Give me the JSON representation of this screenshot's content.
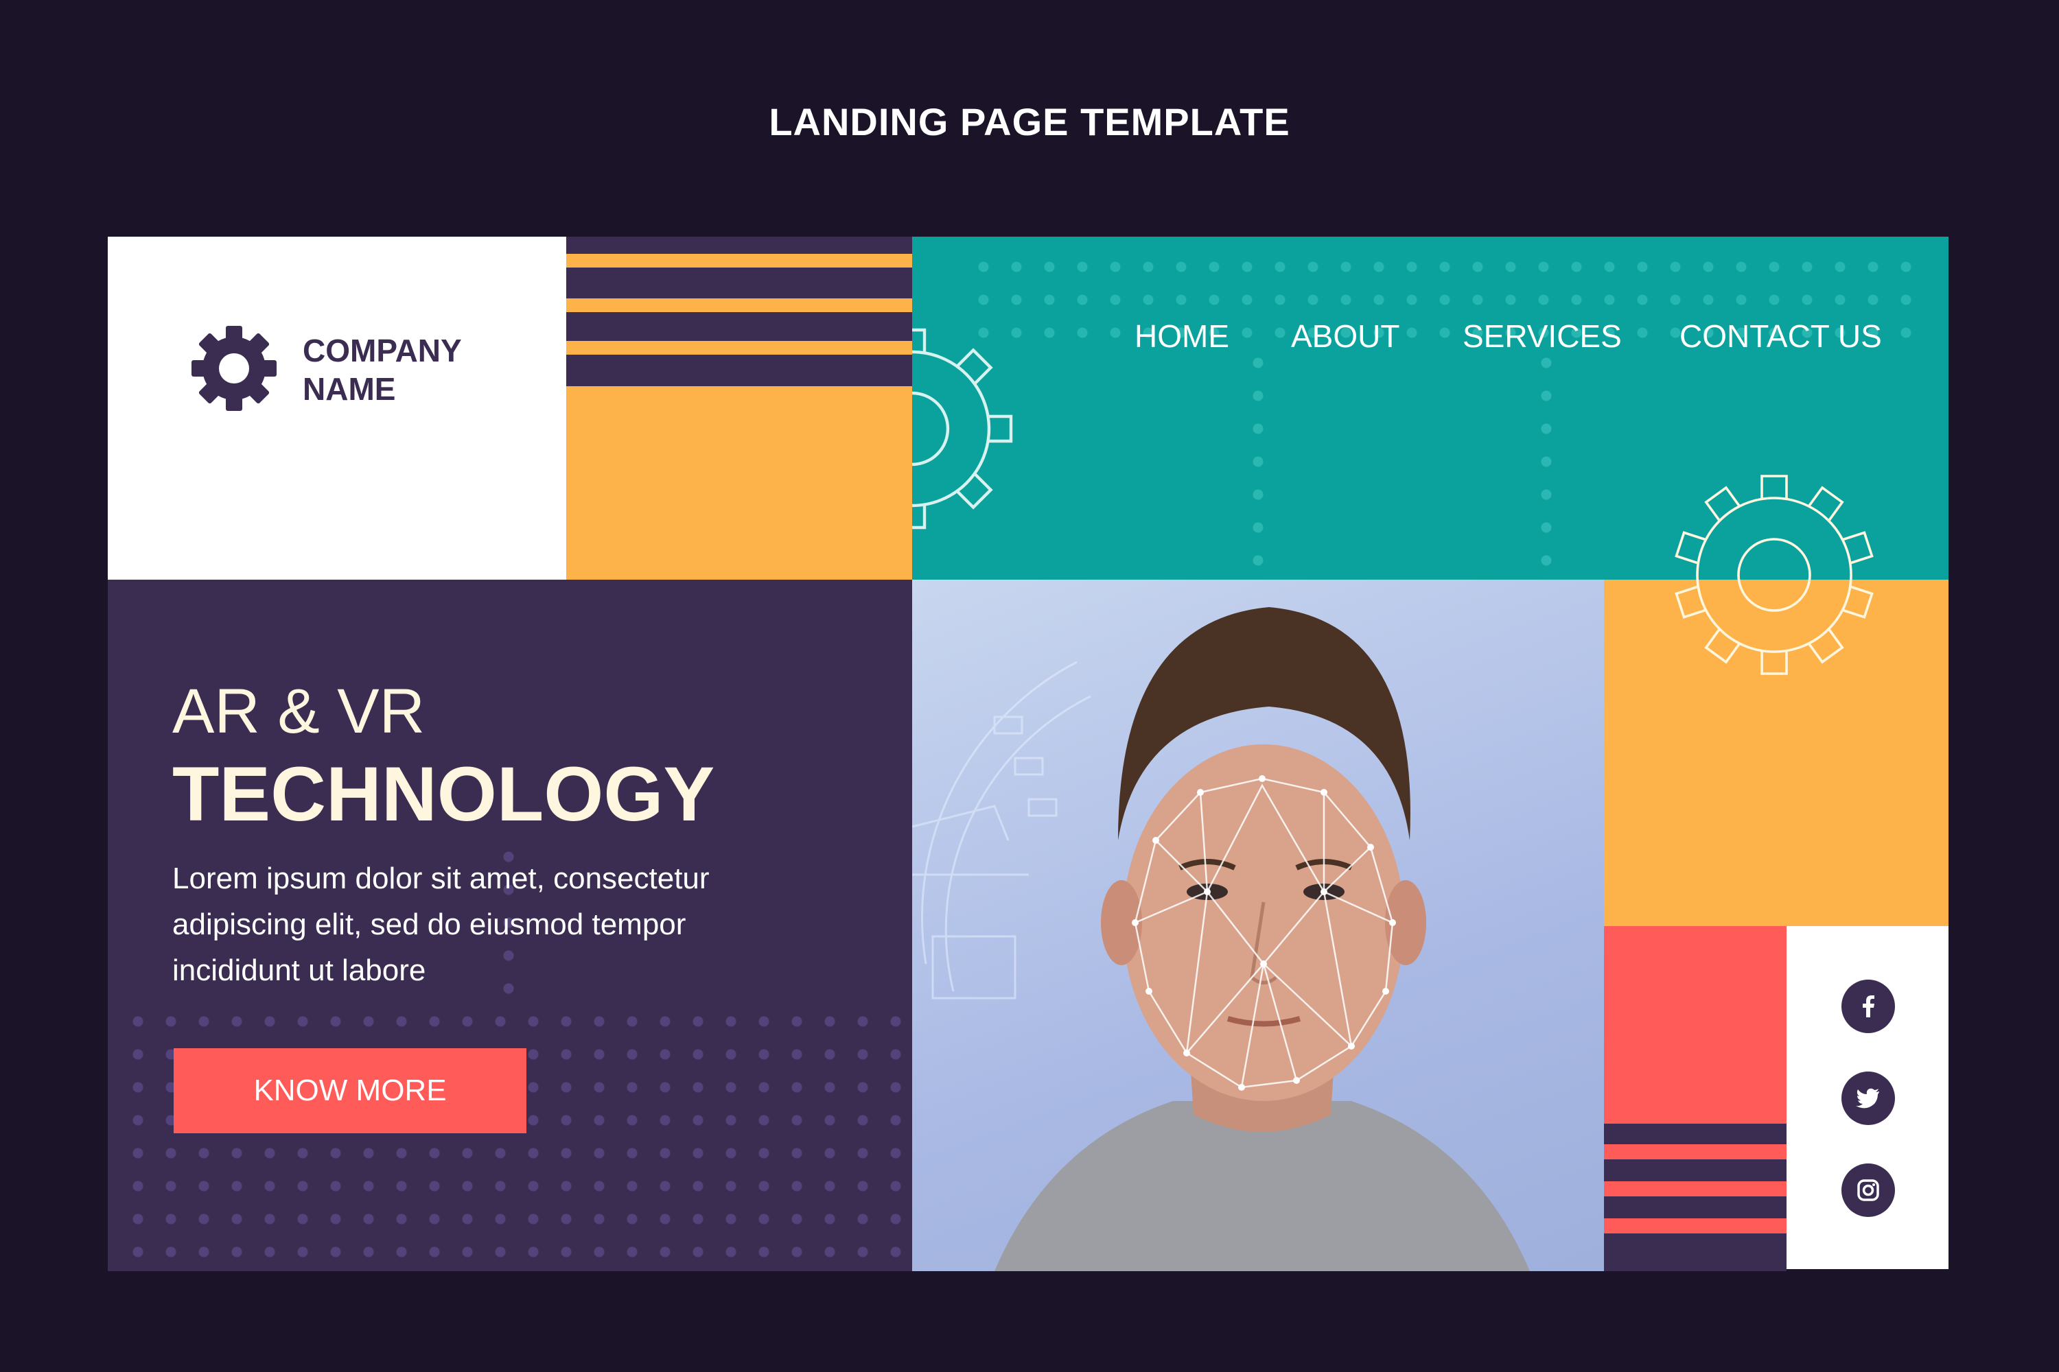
{
  "header": {
    "title": "LANDING PAGE TEMPLATE"
  },
  "brand": {
    "name_line1": "COMPANY",
    "name_line2": "NAME",
    "logo_icon": "gear-icon"
  },
  "nav": {
    "items": [
      "HOME",
      "ABOUT",
      "SERVICES",
      "CONTACT US"
    ]
  },
  "hero": {
    "title_line1": "AR & VR",
    "title_line2": "TECHNOLOGY",
    "body": "Lorem ipsum dolor sit amet, consectetur adipiscing elit, sed do eiusmod tempor incididunt ut labore",
    "cta_label": "KNOW MORE"
  },
  "image": {
    "subject": "person-face-scan-icon"
  },
  "social": {
    "icons": [
      "facebook-icon",
      "twitter-icon",
      "instagram-icon"
    ]
  },
  "colors": {
    "background": "#1b1428",
    "purple": "#3b2d52",
    "teal": "#0ba19d",
    "orange": "#fdb34a",
    "coral": "#ff5b58",
    "white": "#ffffff",
    "cream": "#fff6e0"
  }
}
